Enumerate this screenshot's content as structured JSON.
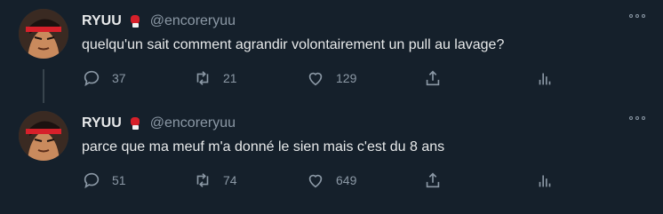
{
  "tweets": [
    {
      "name": "RYUU",
      "handle": "@encoreryuu",
      "text": "quelqu'un sait comment agrandir volontairement un pull au lavage?",
      "replies": "37",
      "retweets": "21",
      "likes": "129"
    },
    {
      "name": "RYUU",
      "handle": "@encoreryuu",
      "text": "parce que ma meuf m'a donné le sien mais c'est du 8 ans",
      "replies": "51",
      "retweets": "74",
      "likes": "649"
    }
  ],
  "colors": {
    "background": "#15202b",
    "text": "#e7e9ea",
    "muted": "#8b98a5",
    "glove": "#d6202a"
  },
  "icons": [
    "boxing-glove-icon",
    "more-icon",
    "reply-icon",
    "retweet-icon",
    "like-icon",
    "share-icon",
    "stats-icon"
  ]
}
